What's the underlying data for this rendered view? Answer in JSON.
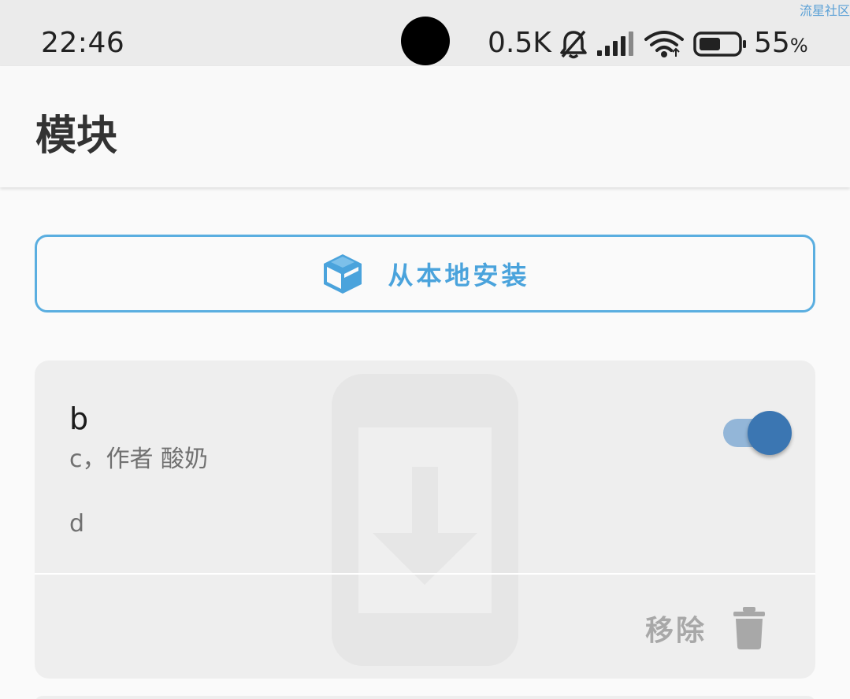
{
  "status_bar": {
    "watermark": "流星社区",
    "time": "22:46",
    "network_speed": "0.5K",
    "battery_level": "55",
    "battery_unit": "%",
    "icons": [
      "bell-muted-icon",
      "signal-icon",
      "wifi-icon",
      "battery-icon"
    ]
  },
  "app_bar": {
    "title": "模块"
  },
  "install": {
    "label": "从本地安装",
    "icon": "package-box-icon",
    "accent_color": "#4aa3dc"
  },
  "modules": [
    {
      "name": "b",
      "subtitle": "c，作者 酸奶",
      "description": "d",
      "enabled": true,
      "remove_label": "移除",
      "remove_icon": "trash-icon",
      "toggle_color": "#3b76b2"
    }
  ]
}
